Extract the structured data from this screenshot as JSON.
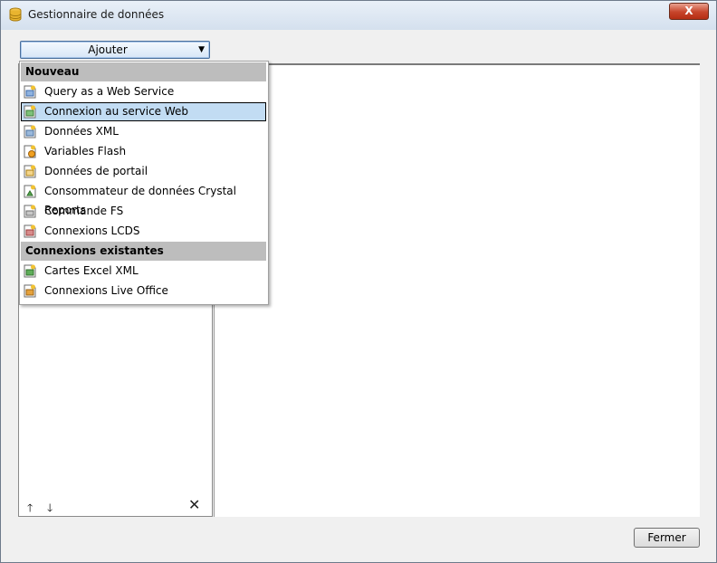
{
  "window": {
    "title": "Gestionnaire de données",
    "close_glyph": "X"
  },
  "toolbar": {
    "add_label": "Ajouter",
    "add_arrow": "▼"
  },
  "menu": {
    "header_new": "Nouveau",
    "new_items": [
      {
        "label": "Query as a Web Service",
        "icon": "web-service-icon"
      },
      {
        "label": "Connexion au service Web",
        "icon": "web-connection-icon",
        "selected": true
      },
      {
        "label": "Données XML",
        "icon": "xml-data-icon"
      },
      {
        "label": "Variables Flash",
        "icon": "flash-variables-icon"
      },
      {
        "label": "Données de portail",
        "icon": "portal-data-icon"
      },
      {
        "label": "Consommateur de données Crystal Reports",
        "icon": "crystal-reports-icon"
      },
      {
        "label": "Commande FS",
        "icon": "fs-command-icon"
      },
      {
        "label": "Connexions LCDS",
        "icon": "lcds-icon"
      }
    ],
    "header_existing": "Connexions existantes",
    "existing_items": [
      {
        "label": "Cartes Excel XML",
        "icon": "excel-xml-icon"
      },
      {
        "label": "Connexions Live Office",
        "icon": "live-office-icon"
      }
    ]
  },
  "panel_controls": {
    "move_up": "🡑",
    "move_down": "🡓",
    "delete": "✕"
  },
  "footer": {
    "close_label": "Fermer"
  },
  "colors": {
    "selection": "#c2dcf3",
    "menu_header": "#bdbdbd",
    "close_red": "#c7442a"
  }
}
